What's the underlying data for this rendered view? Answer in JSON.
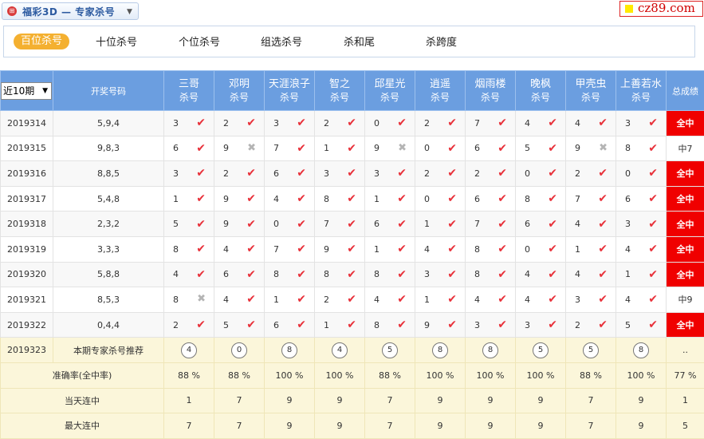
{
  "header": {
    "logo_glyph": "⊞",
    "title": "福彩3D — 专家杀号",
    "dropdown_caret": "▼",
    "brand_text": "cz89.com",
    "brand_colors": {
      "text": "#d10000",
      "square": "#ffea00"
    }
  },
  "tabs": [
    {
      "label": "百位杀号",
      "active": true
    },
    {
      "label": "十位杀号",
      "active": false
    },
    {
      "label": "个位杀号",
      "active": false
    },
    {
      "label": "组选杀号",
      "active": false
    },
    {
      "label": "杀和尾",
      "active": false
    },
    {
      "label": "杀跨度",
      "active": false
    }
  ],
  "table": {
    "period_select": {
      "value": "近10期",
      "caret": "▼"
    },
    "col_draw": "开奖号码",
    "col_total": "总成绩",
    "experts": [
      {
        "name": "三哥",
        "sub": "杀号"
      },
      {
        "name": "邓明",
        "sub": "杀号"
      },
      {
        "name": "天涯浪子",
        "sub": "杀号"
      },
      {
        "name": "智之",
        "sub": "杀号"
      },
      {
        "name": "邱星光",
        "sub": "杀号"
      },
      {
        "name": "逍遥",
        "sub": "杀号"
      },
      {
        "name": "烟雨楼",
        "sub": "杀号"
      },
      {
        "name": "晚枫",
        "sub": "杀号"
      },
      {
        "name": "甲壳虫",
        "sub": "杀号"
      },
      {
        "name": "上善若水",
        "sub": "杀号"
      }
    ],
    "rows": [
      {
        "period": "2019314",
        "draw": "5,9,4",
        "kills": [
          [
            "3",
            "ok"
          ],
          [
            "2",
            "ok"
          ],
          [
            "3",
            "ok"
          ],
          [
            "2",
            "ok"
          ],
          [
            "0",
            "ok"
          ],
          [
            "2",
            "ok"
          ],
          [
            "7",
            "ok"
          ],
          [
            "4",
            "ok"
          ],
          [
            "4",
            "ok"
          ],
          [
            "3",
            "ok"
          ]
        ],
        "result": "全中",
        "hit": true
      },
      {
        "period": "2019315",
        "draw": "9,8,3",
        "kills": [
          [
            "6",
            "ok"
          ],
          [
            "9",
            "bad"
          ],
          [
            "7",
            "ok"
          ],
          [
            "1",
            "ok"
          ],
          [
            "9",
            "bad"
          ],
          [
            "0",
            "ok"
          ],
          [
            "6",
            "ok"
          ],
          [
            "5",
            "ok"
          ],
          [
            "9",
            "bad"
          ],
          [
            "8",
            "ok"
          ]
        ],
        "result": "中7",
        "hit": false
      },
      {
        "period": "2019316",
        "draw": "8,8,5",
        "kills": [
          [
            "3",
            "ok"
          ],
          [
            "2",
            "ok"
          ],
          [
            "6",
            "ok"
          ],
          [
            "3",
            "ok"
          ],
          [
            "3",
            "ok"
          ],
          [
            "2",
            "ok"
          ],
          [
            "2",
            "ok"
          ],
          [
            "0",
            "ok"
          ],
          [
            "2",
            "ok"
          ],
          [
            "0",
            "ok"
          ]
        ],
        "result": "全中",
        "hit": true
      },
      {
        "period": "2019317",
        "draw": "5,4,8",
        "kills": [
          [
            "1",
            "ok"
          ],
          [
            "9",
            "ok"
          ],
          [
            "4",
            "ok"
          ],
          [
            "8",
            "ok"
          ],
          [
            "1",
            "ok"
          ],
          [
            "0",
            "ok"
          ],
          [
            "6",
            "ok"
          ],
          [
            "8",
            "ok"
          ],
          [
            "7",
            "ok"
          ],
          [
            "6",
            "ok"
          ]
        ],
        "result": "全中",
        "hit": true
      },
      {
        "period": "2019318",
        "draw": "2,3,2",
        "kills": [
          [
            "5",
            "ok"
          ],
          [
            "9",
            "ok"
          ],
          [
            "0",
            "ok"
          ],
          [
            "7",
            "ok"
          ],
          [
            "6",
            "ok"
          ],
          [
            "1",
            "ok"
          ],
          [
            "7",
            "ok"
          ],
          [
            "6",
            "ok"
          ],
          [
            "4",
            "ok"
          ],
          [
            "3",
            "ok"
          ]
        ],
        "result": "全中",
        "hit": true
      },
      {
        "period": "2019319",
        "draw": "3,3,3",
        "kills": [
          [
            "8",
            "ok"
          ],
          [
            "4",
            "ok"
          ],
          [
            "7",
            "ok"
          ],
          [
            "9",
            "ok"
          ],
          [
            "1",
            "ok"
          ],
          [
            "4",
            "ok"
          ],
          [
            "8",
            "ok"
          ],
          [
            "0",
            "ok"
          ],
          [
            "1",
            "ok"
          ],
          [
            "4",
            "ok"
          ]
        ],
        "result": "全中",
        "hit": true
      },
      {
        "period": "2019320",
        "draw": "5,8,8",
        "kills": [
          [
            "4",
            "ok"
          ],
          [
            "6",
            "ok"
          ],
          [
            "8",
            "ok"
          ],
          [
            "8",
            "ok"
          ],
          [
            "8",
            "ok"
          ],
          [
            "3",
            "ok"
          ],
          [
            "8",
            "ok"
          ],
          [
            "4",
            "ok"
          ],
          [
            "4",
            "ok"
          ],
          [
            "1",
            "ok"
          ]
        ],
        "result": "全中",
        "hit": true
      },
      {
        "period": "2019321",
        "draw": "8,5,3",
        "kills": [
          [
            "8",
            "bad"
          ],
          [
            "4",
            "ok"
          ],
          [
            "1",
            "ok"
          ],
          [
            "2",
            "ok"
          ],
          [
            "4",
            "ok"
          ],
          [
            "1",
            "ok"
          ],
          [
            "4",
            "ok"
          ],
          [
            "4",
            "ok"
          ],
          [
            "3",
            "ok"
          ],
          [
            "4",
            "ok"
          ]
        ],
        "result": "中9",
        "hit": false
      },
      {
        "period": "2019322",
        "draw": "0,4,4",
        "kills": [
          [
            "2",
            "ok"
          ],
          [
            "5",
            "ok"
          ],
          [
            "6",
            "ok"
          ],
          [
            "1",
            "ok"
          ],
          [
            "8",
            "ok"
          ],
          [
            "9",
            "ok"
          ],
          [
            "3",
            "ok"
          ],
          [
            "3",
            "ok"
          ],
          [
            "2",
            "ok"
          ],
          [
            "5",
            "ok"
          ]
        ],
        "result": "全中",
        "hit": true
      }
    ],
    "recommend": {
      "period": "2019323",
      "label": "本期专家杀号推荐",
      "values": [
        "4",
        "0",
        "8",
        "4",
        "5",
        "8",
        "8",
        "5",
        "5",
        "8"
      ],
      "total": ".."
    },
    "accuracy": {
      "label": "准确率(全中率)",
      "values": [
        "88 %",
        "88 %",
        "100 %",
        "100 %",
        "88 %",
        "100 %",
        "100 %",
        "100 %",
        "88 %",
        "100 %"
      ],
      "total": "77 %"
    },
    "streak_today": {
      "label": "当天连中",
      "values": [
        "1",
        "7",
        "9",
        "9",
        "7",
        "9",
        "9",
        "9",
        "7",
        "9"
      ],
      "total": "1"
    },
    "streak_max": {
      "label": "最大连中",
      "values": [
        "7",
        "7",
        "9",
        "9",
        "7",
        "9",
        "9",
        "9",
        "7",
        "9"
      ],
      "total": "5"
    },
    "marks": {
      "ok": "✔",
      "bad": "✖"
    },
    "colors": {
      "header": "#6b9ee0",
      "hit": "#f00000",
      "check": "#e8313a",
      "summary": "#fbf6da"
    }
  }
}
